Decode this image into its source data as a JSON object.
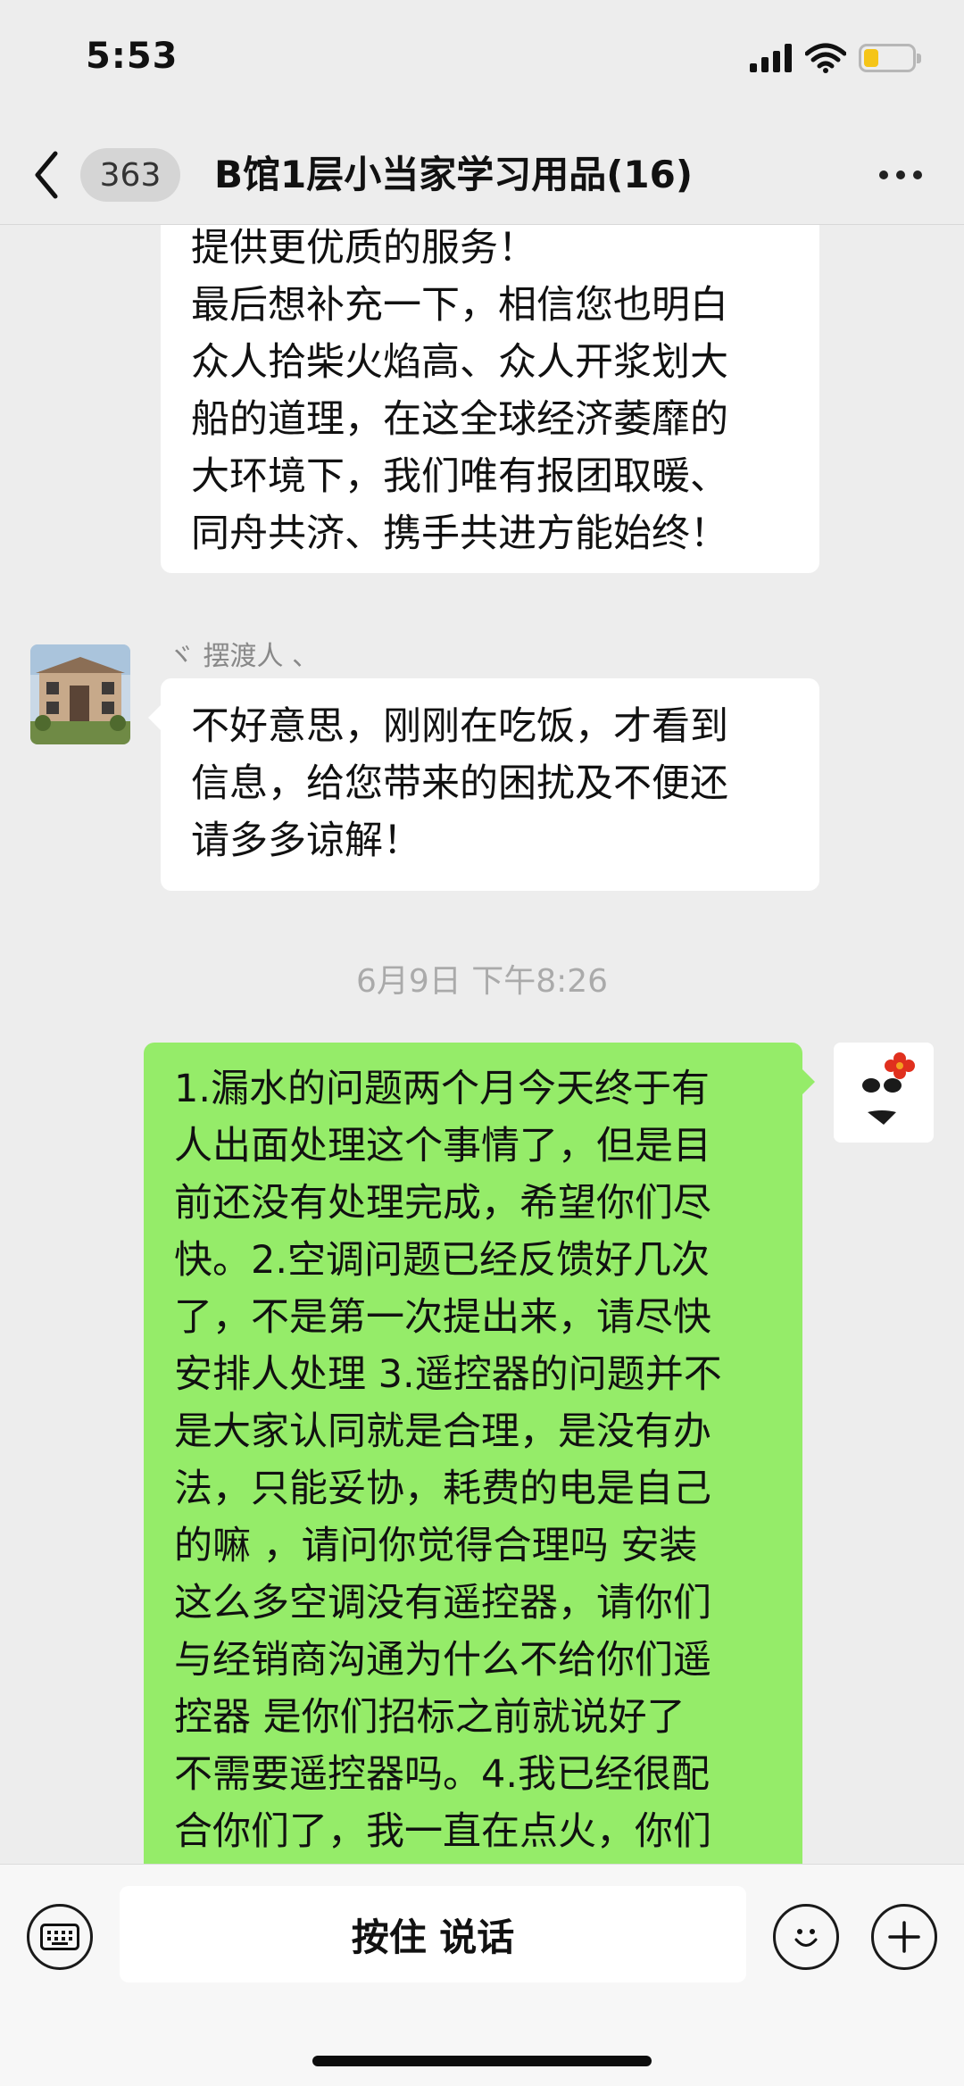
{
  "status_bar": {
    "time": "5:53"
  },
  "nav": {
    "unread_count": "363",
    "title": "B馆1层小当家学习用品(16)"
  },
  "messages": [
    {
      "side": "left",
      "lines": [
        "提供更优质的服务！",
        "最后想补充一下，相信您也明白",
        "众人拾柴火焰高、众人开浆划大",
        "船的道理，在这全球经济萎靡的",
        "大环境下，我们唯有报团取暖、",
        "同舟共济、携手共进方能始终！"
      ]
    },
    {
      "side": "left",
      "sender": "ヾ    摆渡人  、",
      "lines": [
        "不好意思，刚刚在吃饭，才看到",
        "信息，给您带来的困扰及不便还",
        "请多多谅解！"
      ]
    },
    {
      "timestamp": "6月9日 下午8:26"
    },
    {
      "side": "right",
      "lines": [
        "1.漏水的问题两个月今天终于有",
        "人出面处理这个事情了，但是目",
        "前还没有处理完成，希望你们尽",
        "快。2.空调问题已经反馈好几次",
        "了，不是第一次提出来，请尽快",
        "安排人处理 3.遥控器的问题并不",
        "是大家认同就是合理，是没有办",
        "法，只能妥协，耗费的电是自己",
        "的嘛 ，请问你觉得合理吗 安装",
        "这么多空调没有遥控器，请你们",
        "与经销商沟通为什么不给你们遥",
        "控器  是你们招标之前就说好了",
        "不需要遥控器吗。4.我已经很配",
        "合你们了，我一直在点火，你们"
      ]
    }
  ],
  "input_bar": {
    "talk_label": "按住 说话"
  },
  "colors": {
    "background": "#ededed",
    "incoming_bubble": "#ffffff",
    "outgoing_bubble": "#95ec69",
    "battery": "#f5c518"
  },
  "icons": [
    "back-chevron-icon",
    "more-dots-icon",
    "keyboard-icon",
    "emoji-icon",
    "plus-icon",
    "signal-icon",
    "wifi-icon",
    "battery-icon"
  ]
}
